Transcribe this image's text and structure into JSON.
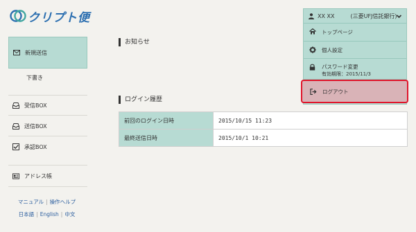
{
  "logo": {
    "text": "クリプト便"
  },
  "sidebar": {
    "items": [
      {
        "label": "新規送信",
        "icon": "mail-icon"
      },
      {
        "label": "下書き"
      },
      {
        "label": "受信BOX",
        "icon": "inbox-icon"
      },
      {
        "label": "送信BOX",
        "icon": "outbox-icon"
      },
      {
        "label": "承認BOX",
        "icon": "checkbox-icon"
      },
      {
        "label": "アドレス帳",
        "icon": "address-book-icon"
      }
    ],
    "links_row1": [
      "マニュアル",
      "操作ヘルプ"
    ],
    "links_row2": [
      "日本語",
      "English",
      "中文"
    ],
    "separator": "|"
  },
  "main": {
    "notice_title": "お知らせ",
    "login_history_title": "ログイン履歴",
    "login_rows": [
      {
        "label": "前回のログイン日時",
        "value": "2015/10/15 11:23"
      },
      {
        "label": "最終送信日時",
        "value": "2015/10/1 10:21"
      }
    ]
  },
  "user_menu": {
    "user_name": "XX XX",
    "bank": "(三菱UFJ信託銀行)",
    "items": {
      "top_page": "トップページ",
      "personal_settings": "個人設定",
      "password_change": "パスワード変更",
      "password_expiry": "有効期限：2015/11/3",
      "logout": "ログアウト"
    }
  },
  "colors": {
    "accent": "#b7dbd3",
    "accent_border": "#98c8bc",
    "background": "#f3f2ee",
    "highlight": "#e0142a",
    "link": "#2a5d9e",
    "logo": "#2c6fb0"
  }
}
